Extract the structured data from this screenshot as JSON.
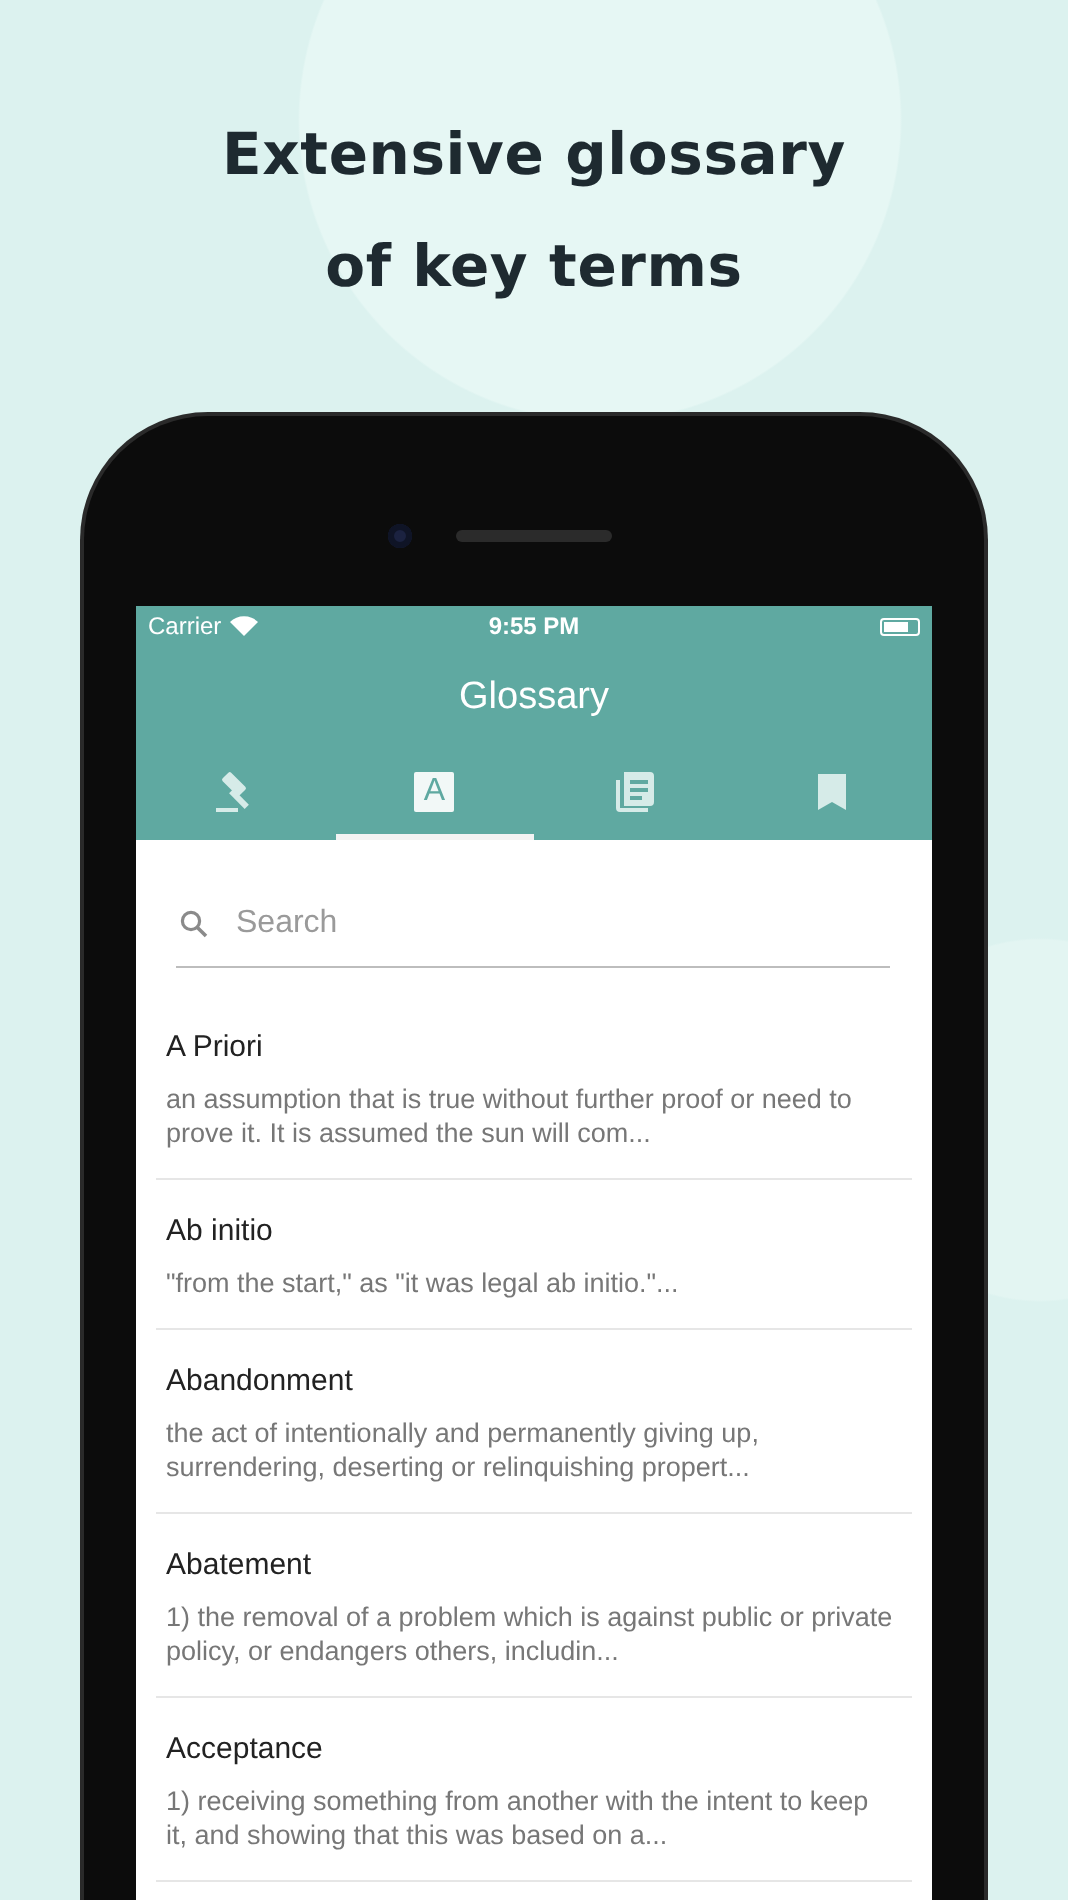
{
  "headline": [
    "Extensive glossary",
    "of key terms"
  ],
  "status_bar": {
    "carrier": "Carrier",
    "time": "9:55 PM"
  },
  "app_bar": {
    "title": "Glossary"
  },
  "tabs": [
    {
      "kind": "gavel",
      "selected": false
    },
    {
      "kind": "letter",
      "glyph": "A",
      "selected": true
    },
    {
      "kind": "articles",
      "selected": false
    },
    {
      "kind": "bookmark",
      "selected": false
    }
  ],
  "search": {
    "placeholder": "Search"
  },
  "terms": [
    {
      "term": "A Priori",
      "definition": "an assumption that is true without further proof or need to prove it. It is assumed the sun will com..."
    },
    {
      "term": "Ab initio",
      "definition": "\"from the start,\" as \"it was legal ab initio.\"..."
    },
    {
      "term": "Abandonment",
      "definition": "the act of intentionally and permanently giving up, surrendering, deserting or relinquishing propert..."
    },
    {
      "term": "Abatement",
      "definition": "1) the removal of a problem which is against public or private policy, or endangers others, includin..."
    },
    {
      "term": "Acceptance",
      "definition": "1) receiving something from another with the intent to keep it, and showing that this was based on a..."
    }
  ]
}
